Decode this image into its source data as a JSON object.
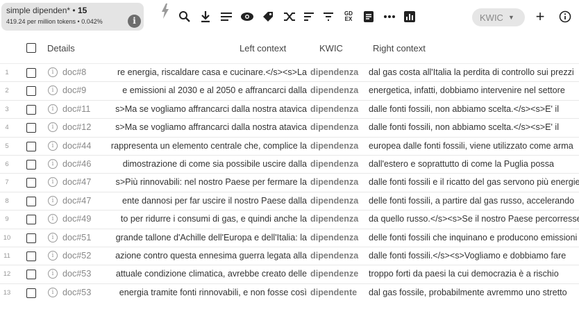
{
  "query": {
    "title": "simple dipenden*",
    "count": "15",
    "stats": "419.24 per million tokens • 0.042%"
  },
  "toolbar": {
    "view_mode": "KWIC",
    "icons": [
      "bolt-icon",
      "search-icon",
      "download-icon",
      "lines-icon",
      "eye-icon",
      "label-icon",
      "shuffle-icon",
      "sort-icon",
      "filter-icon",
      "gdex-icon",
      "document-icon",
      "ellipsis-icon",
      "chart-icon",
      "plus-icon",
      "info-icon"
    ],
    "gdex_label": "GD\nEX"
  },
  "columns": {
    "details": "Details",
    "left": "Left context",
    "kwic": "KWIC",
    "right": "Right context"
  },
  "rows": [
    {
      "n": "1",
      "doc": "doc#8",
      "left": "re energia, riscaldare casa e cucinare.</s><s>La",
      "kwic": "dipendenza",
      "right": "dal gas costa all'Italia la perdita di controllo sui prezzi"
    },
    {
      "n": "2",
      "doc": "doc#9",
      "left": "e emissioni al 2030 e al 2050 e affrancarci dalla",
      "kwic": "dipendenza",
      "right": "energetica, infatti, dobbiamo intervenire nel settore"
    },
    {
      "n": "3",
      "doc": "doc#11",
      "left": "s>Ma se vogliamo affrancarci dalla nostra atavica",
      "kwic": "dipendenza",
      "right": "dalle fonti fossili, non abbiamo scelta.</s><s>E' il"
    },
    {
      "n": "4",
      "doc": "doc#12",
      "left": "s>Ma se vogliamo affrancarci dalla nostra atavica",
      "kwic": "dipendenza",
      "right": "dalle fonti fossili, non abbiamo scelta.</s><s>E' il"
    },
    {
      "n": "5",
      "doc": "doc#44",
      "left": "rappresenta un elemento centrale che, complice la",
      "kwic": "dipendenza",
      "right": "europea dalle fonti fossili, viene utilizzato come arma"
    },
    {
      "n": "6",
      "doc": "doc#46",
      "left": "dimostrazione di come sia possibile uscire dalla",
      "kwic": "dipendenza",
      "right": "dall'estero e soprattutto di come la Puglia possa"
    },
    {
      "n": "7",
      "doc": "doc#47",
      "left": "s>Più rinnovabili: nel nostro Paese per fermare la",
      "kwic": "dipendenza",
      "right": "dalle fonti fossili e il ricatto del gas servono più energie"
    },
    {
      "n": "8",
      "doc": "doc#47",
      "left": "ente dannosi per far uscire il nostro Paese dalla",
      "kwic": "dipendenza",
      "right": "delle fonti fossili, a partire dal gas russo, accelerando"
    },
    {
      "n": "9",
      "doc": "doc#49",
      "left": "to per ridurre i consumi di gas, e quindi anche la",
      "kwic": "dipendenza",
      "right": "da quello russo.</s><s>Se il nostro Paese percorresse"
    },
    {
      "n": "10",
      "doc": "doc#51",
      "left": "grande tallone d'Achille dell'Europa e dell'Italia: la",
      "kwic": "dipendenza",
      "right": "delle fonti fossili che inquinano e producono emissioni"
    },
    {
      "n": "11",
      "doc": "doc#52",
      "left": "azione contro questa ennesima guerra legata alla",
      "kwic": "dipendenza",
      "right": "dalle fonti fossili.</s><s>Vogliamo e dobbiamo fare"
    },
    {
      "n": "12",
      "doc": "doc#53",
      "left": "attuale condizione climatica, avrebbe creato delle",
      "kwic": "dipendenze",
      "right": "troppo forti da paesi la cui democrazia è a rischio"
    },
    {
      "n": "13",
      "doc": "doc#53",
      "left": "energia tramite fonti rinnovabili, e non fosse così",
      "kwic": "dipendente",
      "right": "dal gas fossile, probabilmente avremmo uno stretto"
    }
  ]
}
